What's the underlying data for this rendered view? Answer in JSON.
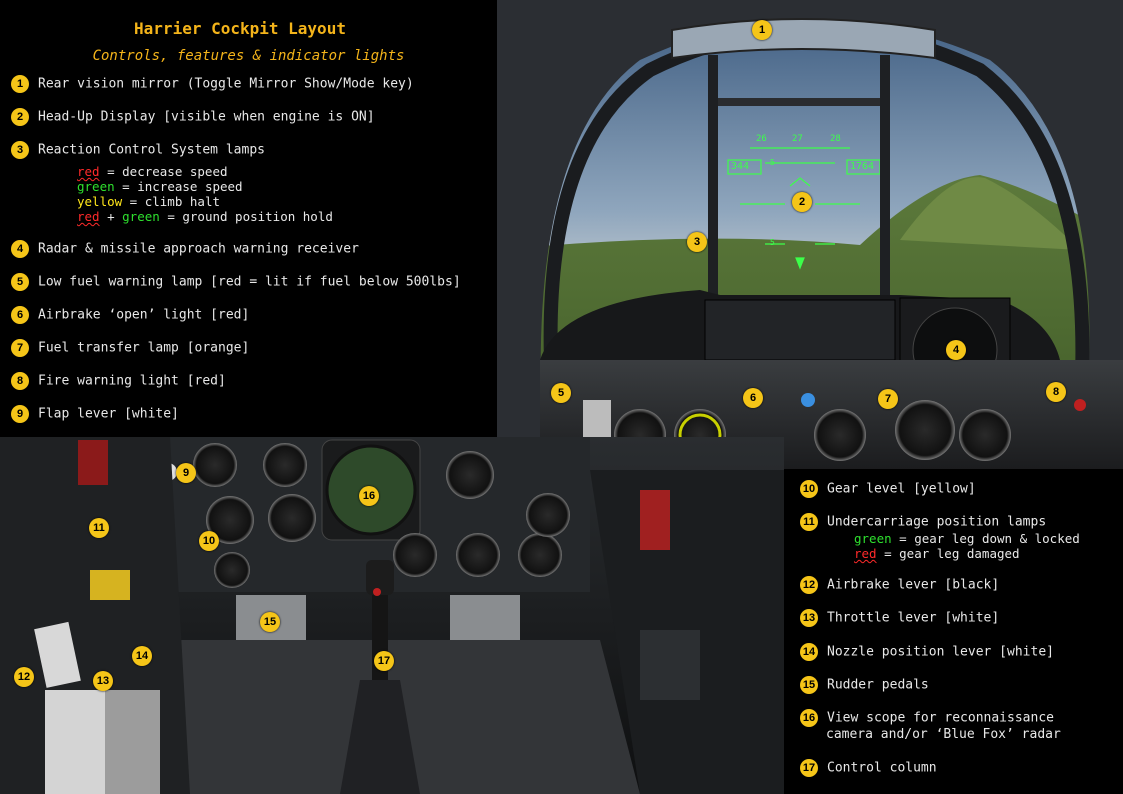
{
  "title": "Harrier Cockpit Layout",
  "subtitle": "Controls, features & indicator lights",
  "items_top": [
    {
      "n": "1",
      "text": "Rear vision mirror (Toggle Mirror Show/Mode key)"
    },
    {
      "n": "2",
      "text": "Head-Up Display [visible when engine is ON]"
    },
    {
      "n": "3",
      "text": "Reaction Control System lamps"
    },
    {
      "n": "4",
      "text": "Radar & missile approach warning receiver"
    },
    {
      "n": "5",
      "text": "Low fuel warning lamp [red = lit if fuel below 500lbs]"
    },
    {
      "n": "6",
      "text": "Airbrake ‘open’ light [red]"
    },
    {
      "n": "7",
      "text": "Fuel transfer lamp [orange]"
    },
    {
      "n": "8",
      "text": "Fire warning light [red]"
    },
    {
      "n": "9",
      "text": "Flap lever [white]"
    }
  ],
  "rcs_lamps": {
    "red1": "red",
    "red1_desc": " = decrease speed",
    "green1": "green",
    "green1_desc": " = increase speed",
    "yellow": "yellow",
    "yellow_desc": " = climb halt",
    "red2": "red",
    "plus": " + ",
    "green2": "green",
    "combo_desc": " = ground position hold"
  },
  "items_bottom": [
    {
      "n": "10",
      "text": "Gear level [yellow]"
    },
    {
      "n": "11",
      "text": "Undercarriage position lamps"
    },
    {
      "n": "12",
      "text": "Airbrake lever [black]"
    },
    {
      "n": "13",
      "text": "Throttle lever [white]"
    },
    {
      "n": "14",
      "text": "Nozzle position lever [white]"
    },
    {
      "n": "15",
      "text": "Rudder pedals"
    },
    {
      "n": "16",
      "text": "View scope for reconnaissance"
    },
    {
      "n": "16b",
      "text": "camera and/or ‘Blue Fox’ radar"
    },
    {
      "n": "17",
      "text": "Control column"
    }
  ],
  "gear_lamps": {
    "green": "green",
    "green_desc": " = gear leg down & locked",
    "red": "red",
    "red_desc": " = gear leg damaged"
  },
  "hud": {
    "heading_left": "26",
    "heading_mid": "27",
    "heading_right": "28",
    "speed": "344",
    "altitude": "1764",
    "pitch_upper": "5",
    "pitch_lower": "5"
  },
  "markers": [
    "1",
    "2",
    "3",
    "4",
    "5",
    "6",
    "7",
    "8",
    "9",
    "10",
    "11",
    "12",
    "13",
    "14",
    "15",
    "16",
    "17"
  ],
  "colors": {
    "accent": "#f4b41a",
    "marker": "#f5c518",
    "hud": "#3cff4a"
  }
}
